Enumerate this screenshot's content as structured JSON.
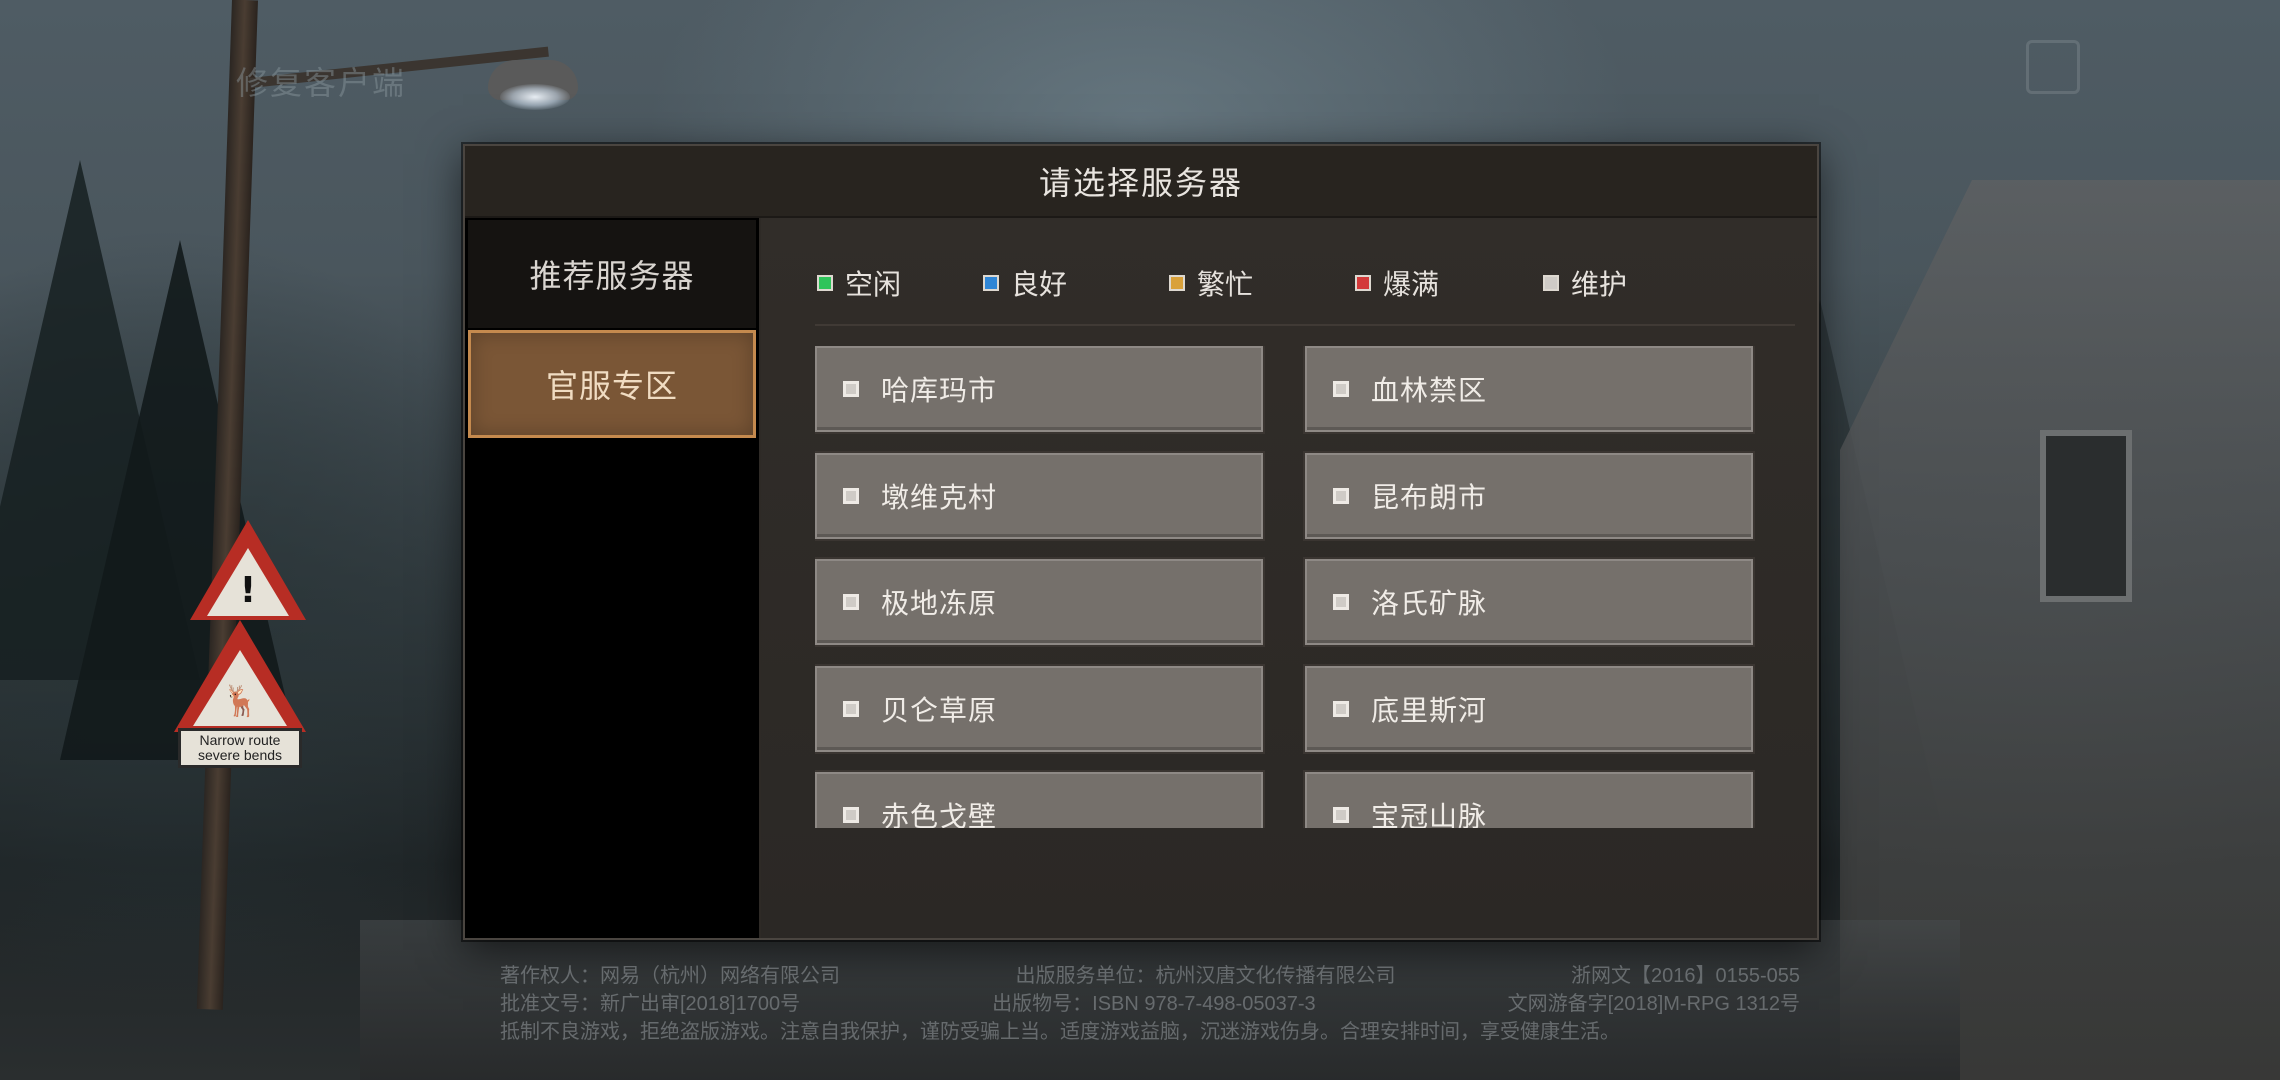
{
  "background": {
    "corner_label": "修复客户端",
    "road_sign_text": "Narrow route severe bends"
  },
  "dialog": {
    "title": "请选择服务器",
    "sidebar": {
      "items": [
        {
          "label": "推荐服务器",
          "selected": false
        },
        {
          "label": "官服专区",
          "selected": true
        }
      ]
    },
    "legend": [
      {
        "label": "空闲",
        "color": "#2ec45a"
      },
      {
        "label": "良好",
        "color": "#2f86d6"
      },
      {
        "label": "繁忙",
        "color": "#d9a13a"
      },
      {
        "label": "爆满",
        "color": "#d33a3a"
      },
      {
        "label": "维护",
        "color": "#cfcbc6"
      }
    ],
    "servers": [
      {
        "name": "哈库玛市",
        "status": "维护"
      },
      {
        "name": "血林禁区",
        "status": "维护"
      },
      {
        "name": "墩维克村",
        "status": "维护"
      },
      {
        "name": "昆布朗市",
        "status": "维护"
      },
      {
        "name": "极地冻原",
        "status": "维护"
      },
      {
        "name": "洛氏矿脉",
        "status": "维护"
      },
      {
        "name": "贝仑草原",
        "status": "维护"
      },
      {
        "name": "底里斯河",
        "status": "维护"
      },
      {
        "name": "赤色戈壁",
        "status": "维护"
      },
      {
        "name": "宝冠山脉",
        "status": "维护"
      }
    ]
  },
  "footer": {
    "rows": [
      [
        "著作权人：网易（杭州）网络有限公司",
        "出版服务单位：杭州汉唐文化传播有限公司",
        "浙网文【2016】0155-055"
      ],
      [
        "批准文号：新广出审[2018]1700号",
        "出版物号：ISBN 978-7-498-05037-3",
        "文网游备字[2018]M-RPG 1312号"
      ],
      [
        "抵制不良游戏，拒绝盗版游戏。注意自我保护，谨防受骗上当。适度游戏益脑，沉迷游戏伤身。合理安排时间，享受健康生活。"
      ]
    ]
  }
}
